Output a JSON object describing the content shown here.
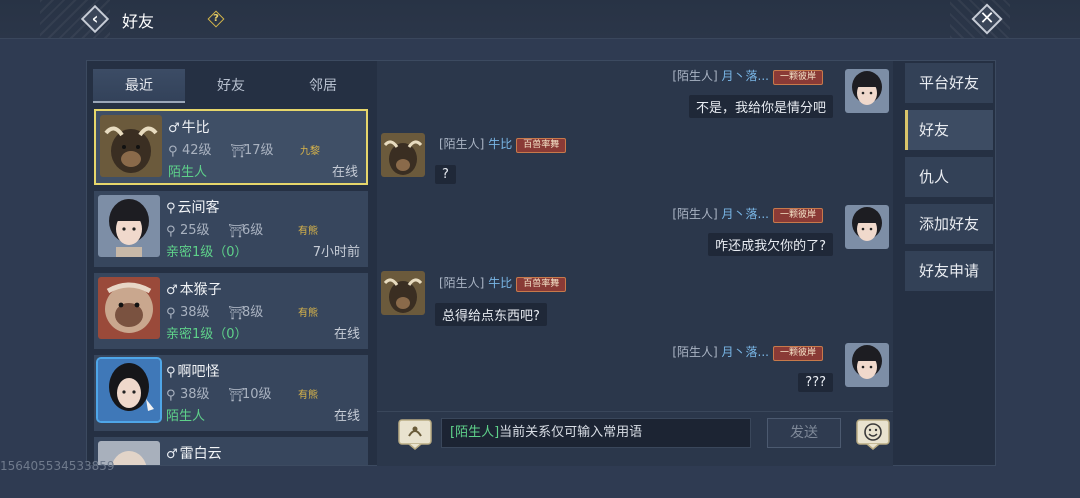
{
  "header": {
    "title": "好友",
    "help_glyph": "?",
    "back_icon": "chevron-left-icon",
    "close_icon": "close-icon"
  },
  "tabs": [
    "最近",
    "好友",
    "邻居"
  ],
  "friends": [
    {
      "name": "牛比",
      "gender": "♂",
      "level": "42级",
      "level2": "17级",
      "tag": "九黎",
      "relation": "陌生人",
      "status": "在线"
    },
    {
      "name": "云间客",
      "gender": "⚲",
      "level": "25级",
      "level2": "6级",
      "tag": "有熊",
      "relation": "亲密1级（0）",
      "status": "7小时前"
    },
    {
      "name": "本猴子",
      "gender": "♂",
      "level": "38级",
      "level2": "8级",
      "tag": "有熊",
      "relation": "亲密1级（0）",
      "status": "在线"
    },
    {
      "name": "啊吧怪",
      "gender": "⚲",
      "level": "38级",
      "level2": "10级",
      "tag": "有熊",
      "relation": "陌生人",
      "status": "在线"
    },
    {
      "name": "雷白云",
      "gender": "♂",
      "level": "",
      "level2": "",
      "tag": "",
      "relation": "",
      "status": ""
    }
  ],
  "messages": [
    {
      "prefix": "[陌生人]",
      "name": "月丶落...",
      "badge": "一颗彼岸",
      "text": "不是，我给你是情分吧"
    },
    {
      "prefix": "[陌生人]",
      "name": "牛比",
      "badge": "百兽率舞",
      "text": "?"
    },
    {
      "prefix": "[陌生人]",
      "name": "月丶落...",
      "badge": "一颗彼岸",
      "text": "咋还成我欠你的了?"
    },
    {
      "prefix": "[陌生人]",
      "name": "牛比",
      "badge": "百兽率舞",
      "text": "总得给点东西吧?"
    },
    {
      "prefix": "[陌生人]",
      "name": "月丶落...",
      "badge": "一颗彼岸",
      "text": "???"
    }
  ],
  "input": {
    "hint_prefix": "[陌生人]",
    "hint_text": "当前关系仅可输入常用语",
    "send_label": "发送"
  },
  "menu": [
    "平台好友",
    "好友",
    "仇人",
    "添加好友",
    "好友申请"
  ],
  "watermark": "156405534533859",
  "colors": {
    "highlight": "#e6d66b",
    "online_green": "#5ed18a",
    "name_blue": "#79b6e6",
    "badge_red": "#8a3a36",
    "tag_gold": "#d8b44a"
  }
}
